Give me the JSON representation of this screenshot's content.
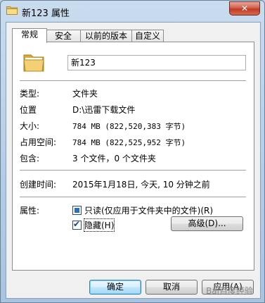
{
  "window": {
    "title": "新123 属性",
    "close_label": "✕"
  },
  "tabs": [
    {
      "label": "常规",
      "active": true
    },
    {
      "label": "安全",
      "active": false
    },
    {
      "label": "以前的版本",
      "active": false
    },
    {
      "label": "自定义",
      "active": false
    }
  ],
  "general": {
    "name_value": "新123",
    "fields": {
      "type_label": "类型:",
      "type_value": "文件夹",
      "location_label": "位置",
      "location_value": "D:\\迅雷下载文件",
      "size_label": "大小:",
      "size_value": "784 MB (822,520,383 字节)",
      "disk_size_label": "占用空间:",
      "disk_size_value": "784 MB (822,525,952 字节)",
      "contains_label": "包含:",
      "contains_value": "3 个文件，0 个文件夹",
      "created_label": "创建时间:",
      "created_value": "2015年1月18日, 今天, 10 分钟之前"
    },
    "attributes": {
      "label": "属性:",
      "readonly_label": "只读(仅应用于文件夹中的文件)(R)",
      "readonly_state": "indeterminate",
      "hidden_label": "隐藏(H)",
      "hidden_checked": true,
      "advanced_label": "高级(D)..."
    }
  },
  "buttons": {
    "ok": "确定",
    "cancel": "取消",
    "apply": "应用(A)"
  },
  "watermark": "Bai百度经验",
  "colors": {
    "folder_yellow": "#e8c15a",
    "accent_blue": "#3c7fb1"
  }
}
